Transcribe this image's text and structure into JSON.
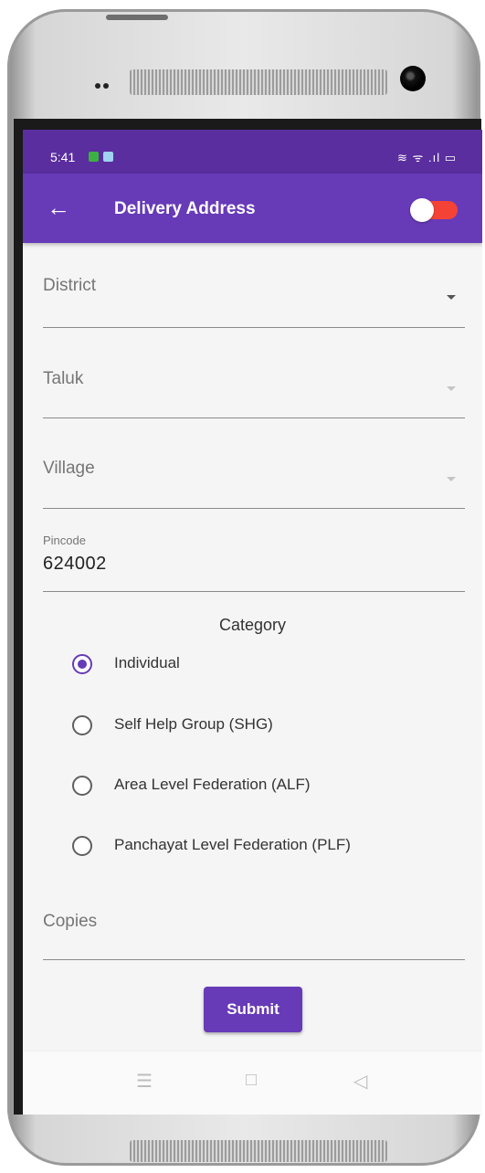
{
  "status_bar": {
    "time": "5:41",
    "right_icons": "wifi signal battery"
  },
  "app_bar": {
    "title": "Delivery Address",
    "back_icon": "arrow-left-icon",
    "toggle_on": false
  },
  "form": {
    "district_label": "District",
    "taluk_label": "Taluk",
    "village_label": "Village",
    "pincode_label": "Pincode",
    "pincode_value": "624002",
    "category_title": "Category",
    "category_options": [
      {
        "label": "Individual",
        "selected": true
      },
      {
        "label": "Self Help Group (SHG)",
        "selected": false
      },
      {
        "label": "Area Level Federation (ALF)",
        "selected": false
      },
      {
        "label": "Panchayat Level Federation (PLF)",
        "selected": false
      }
    ],
    "copies_label": "Copies",
    "submit_label": "Submit"
  },
  "nav_bar": {
    "menu_icon": "☰",
    "home_icon": "□",
    "back_icon": "◁"
  },
  "colors": {
    "primary": "#673ab7",
    "status_bar": "#5a2e9e",
    "toggle_track": "#f44336"
  }
}
